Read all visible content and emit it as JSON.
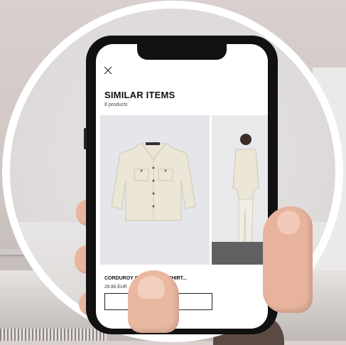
{
  "screen": {
    "close_icon": "close-icon",
    "title": "SIMILAR ITEMS",
    "subtitle": "8 products"
  },
  "products": [
    {
      "name": "CORDUROY OVE[obscured] OVERSHIRT...",
      "name_visible": "CORDUROY OVE",
      "name_tail": "VERSHIRT...",
      "price": "29.95 EUR"
    }
  ],
  "colors": {
    "lens_border": "#ffffff",
    "phone_body": "#111111",
    "screen_bg": "#ffffff",
    "card_bg": "#e5e6ea",
    "jacket": "#ece6d6"
  }
}
